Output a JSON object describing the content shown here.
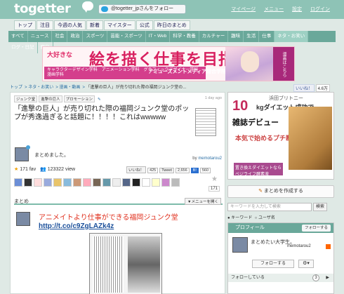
{
  "header": {
    "logo": "togetter",
    "follow_button": "@togetter_jpさんをフォロー",
    "links": [
      "マイページ",
      "メニュー",
      "設定",
      "ログイン"
    ]
  },
  "nav_top": [
    "トップ",
    "注目",
    "今週の人気",
    "新着",
    "マイスター",
    "公式",
    "昨日のまとめ"
  ],
  "nav_categories": [
    "すべて",
    "ニュース",
    "社会",
    "政治",
    "スポーツ",
    "芸能・スポーツ",
    "IT・Web",
    "科学・教養",
    "カルチャー",
    "趣味",
    "生活",
    "仕事",
    "ネタ・お笑い",
    "ログ・日記",
    "腐向"
  ],
  "nav_active_index": 12,
  "banner": {
    "tag": "大好きな",
    "headline": "絵を描く仕事を目指す!",
    "subline": "キャラクターデザイン学科　アニメーション学科　グラフィックデザイナー学科　漫画学科",
    "school": "アミューズメントメディア総合学院",
    "side": "漫画はこちら"
  },
  "breadcrumb": [
    "トップ",
    "ネタ・お笑い",
    "漫画・動画",
    "「進撃の巨人」が売り切れた際の福岡ジュンク堂の..."
  ],
  "fb_like": {
    "label": "いいね！",
    "count": "4.6万"
  },
  "tags": [
    "ジュンク堂",
    "進撃の巨人",
    "プロモーション"
  ],
  "ago": "1 day ago",
  "title": "「進撃の巨人」が売り切れた際の福岡ジュンク堂のポップが秀逸過ぎると話題に！！！！これはwwwww",
  "description": "まとめました。",
  "author_prefix": "by",
  "author": "memotarou2",
  "fav": "171 fav",
  "views": "123322 view",
  "shares": {
    "like": "いいね！",
    "like_n": "425",
    "tweet": "Tweet",
    "tweet_n": "2,656",
    "hatena_n": "560"
  },
  "star_count": "171",
  "summary_heading": "まとめ",
  "menu_button": "▼メニューを開く",
  "tweet_text": "アニメイトより仕事ができる福岡ジュンク堂",
  "tweet_url": "http://t.co/c9ZgLAZk4z",
  "sidebar_ad": {
    "name": "浜田ブリトニー",
    "big": "10",
    "unit": "kgダイエット成功で",
    "debut": "雑誌デビュー",
    "honki": "本気で始めるプチ断食!",
    "badge": "置き換えダイエットならベジライフ酵素液"
  },
  "make_button": "まとめを作成する",
  "search": {
    "placeholder": "キーワードを入力して検索",
    "button": "検索",
    "opt1": "キーワード",
    "opt2": "ユーザ名"
  },
  "profile": {
    "heading": "プロフィール",
    "follow_btn": "フォローする",
    "name": "まとめたい大学生。",
    "user": "memotarou2",
    "follow": "フォローする",
    "following": "フォローしている",
    "following_n": "3"
  }
}
